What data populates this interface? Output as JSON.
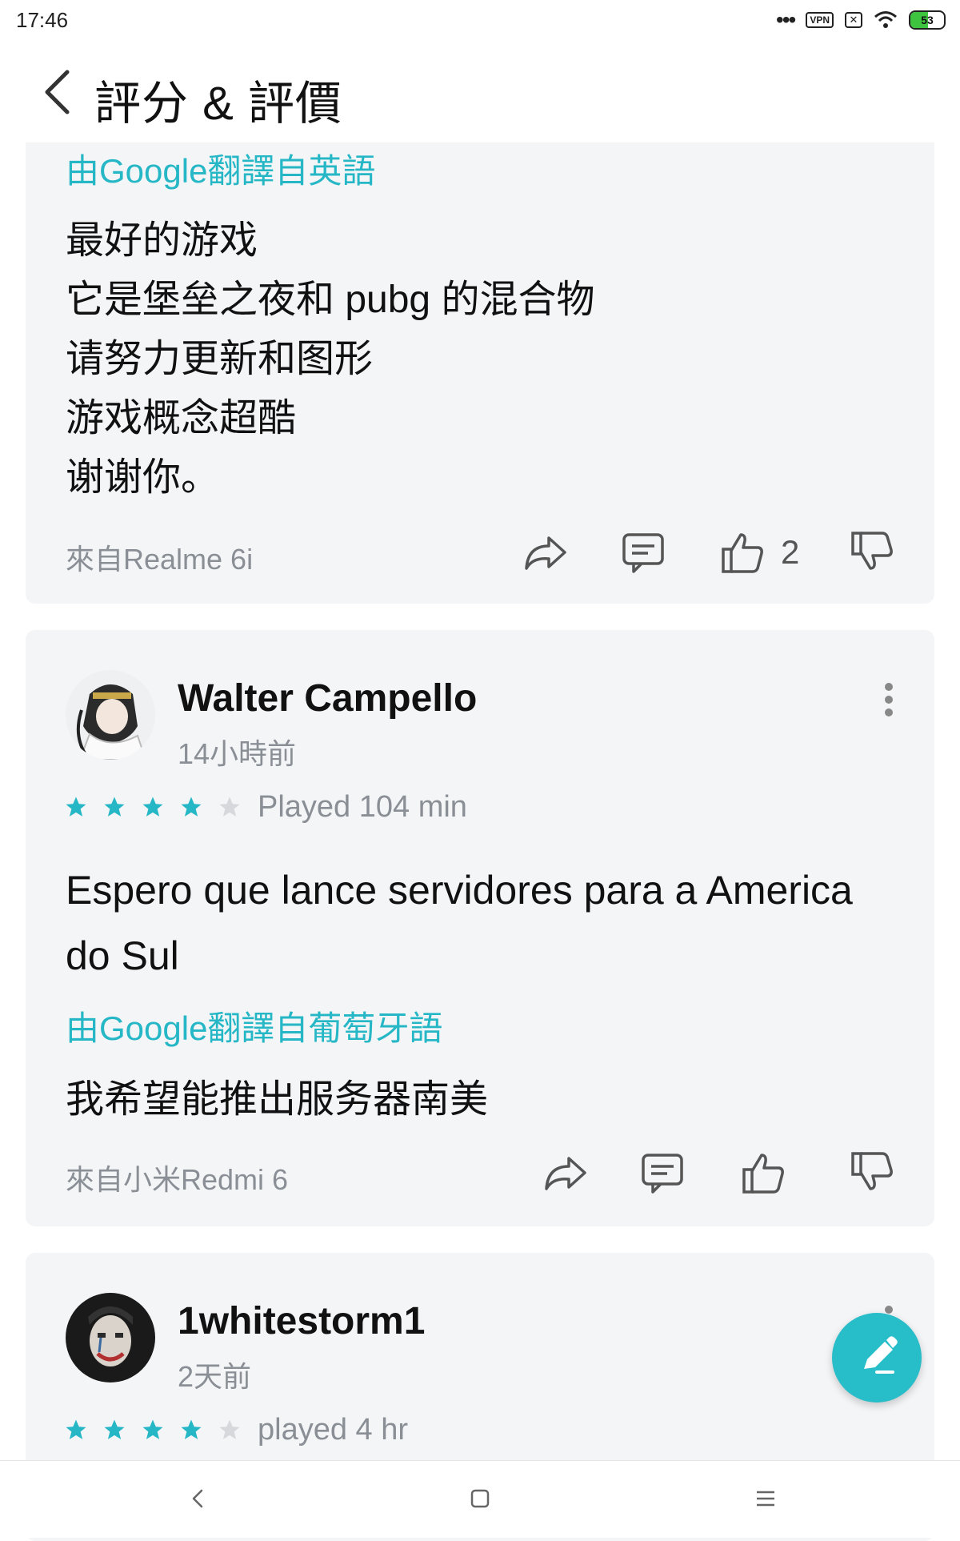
{
  "status_bar": {
    "time": "17:46",
    "vpn_label": "VPN",
    "battery_level": "53",
    "battery_fraction": 0.53,
    "icons": [
      "more-dots-icon",
      "vpn-icon",
      "notification-off-icon",
      "wifi-icon",
      "battery-icon"
    ]
  },
  "header": {
    "title": "評分 & 評價"
  },
  "reviews": [
    {
      "translated_label": "由Google翻譯自英語",
      "translated_lines": [
        "最好的游戏",
        "它是堡垒之夜和 pubg 的混合物",
        "请努力更新和图形",
        "游戏概念超酷",
        "谢谢你。"
      ],
      "device": "來自Realme 6i",
      "like_count": "2"
    },
    {
      "author": "Walter Campello",
      "time": "14小時前",
      "rating": 4,
      "played": "Played 104 min",
      "text": "Espero que lance servidores para a America do Sul",
      "translated_label": "由Google翻譯自葡萄牙語",
      "translated_text": "我希望能推出服务器南美",
      "device": "來自小米Redmi 6"
    },
    {
      "author": "1whitestorm1",
      "time": "2天前",
      "rating": 4,
      "played": "played 4 hr"
    }
  ],
  "colors": {
    "accent": "#25b7c6",
    "star_filled": "#25b7c6",
    "star_empty": "#d6d8db",
    "card_bg": "#f4f5f7",
    "fab": "#27bdc9"
  }
}
